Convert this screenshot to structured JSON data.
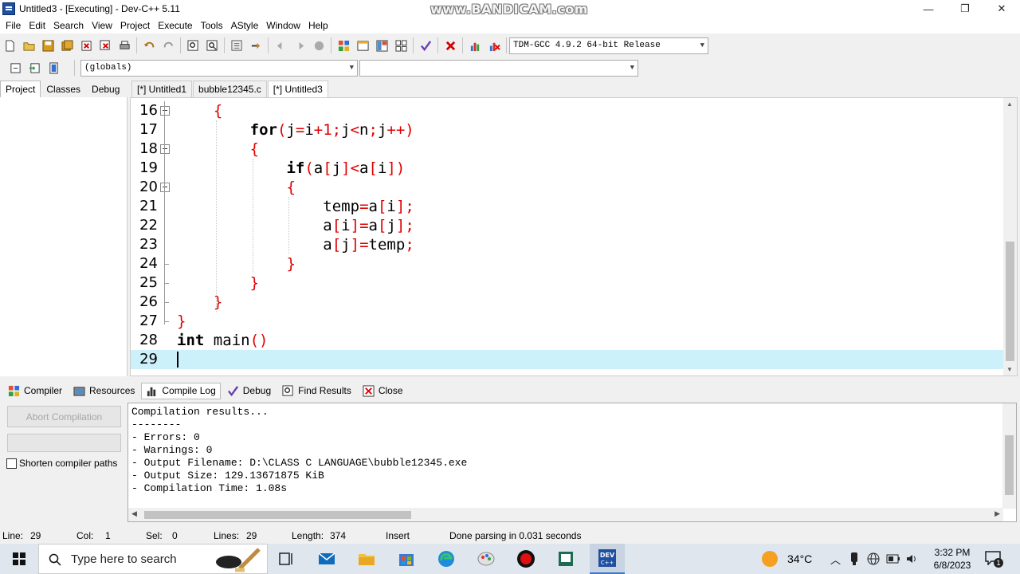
{
  "window": {
    "title": "Untitled3 - [Executing] - Dev-C++ 5.11",
    "watermark": "www.BANDICAM.com",
    "minimize": "—",
    "maximize": "❐",
    "close": "✕"
  },
  "menu": [
    "File",
    "Edit",
    "Search",
    "View",
    "Project",
    "Execute",
    "Tools",
    "AStyle",
    "Window",
    "Help"
  ],
  "toolbar": {
    "compiler_select": "TDM-GCC 4.9.2 64-bit Release",
    "scope_select": "(globals)",
    "member_select": ""
  },
  "left_tabs": [
    "Project",
    "Classes",
    "Debug"
  ],
  "editor_tabs": [
    "[*] Untitled1",
    "bubble12345.c",
    "[*] Untitled3"
  ],
  "code_lines": [
    {
      "n": "16",
      "text": "    {"
    },
    {
      "n": "17",
      "text": "        for(j=i+1;j<n;j++)"
    },
    {
      "n": "18",
      "text": "        {"
    },
    {
      "n": "19",
      "text": "            if(a[j]<a[i])"
    },
    {
      "n": "20",
      "text": "            {"
    },
    {
      "n": "21",
      "text": "                temp=a[i];"
    },
    {
      "n": "22",
      "text": "                a[i]=a[j];"
    },
    {
      "n": "23",
      "text": "                a[j]=temp;"
    },
    {
      "n": "24",
      "text": "            }"
    },
    {
      "n": "25",
      "text": "        }"
    },
    {
      "n": "26",
      "text": "    }"
    },
    {
      "n": "27",
      "text": "}"
    },
    {
      "n": "28",
      "text": "int main()"
    },
    {
      "n": "29",
      "text": ""
    }
  ],
  "bottom_tabs": [
    "Compiler",
    "Resources",
    "Compile Log",
    "Debug",
    "Find Results",
    "Close"
  ],
  "compiler_panel": {
    "abort_label": "Abort Compilation",
    "shorten_label": "Shorten compiler paths",
    "shorten_checked": false
  },
  "compile_log": [
    "Compilation results...",
    "--------",
    "- Errors: 0",
    "- Warnings: 0",
    "- Output Filename: D:\\CLASS C LANGUAGE\\bubble12345.exe",
    "- Output Size: 129.13671875 KiB",
    "- Compilation Time: 1.08s"
  ],
  "status": {
    "line_label": "Line:",
    "line": "29",
    "col_label": "Col:",
    "col": "1",
    "sel_label": "Sel:",
    "sel": "0",
    "lines_label": "Lines:",
    "lines": "29",
    "length_label": "Length:",
    "length": "374",
    "mode": "Insert",
    "message": "Done parsing in 0.031 seconds"
  },
  "taskbar": {
    "search_placeholder": "Type here to search",
    "temperature": "34°C",
    "time": "3:32 PM",
    "date": "6/8/2023",
    "notifications": "1"
  },
  "colors": {
    "current_line": "#cdf1fb",
    "symbol": "#e00000",
    "keyword": "#000000"
  }
}
